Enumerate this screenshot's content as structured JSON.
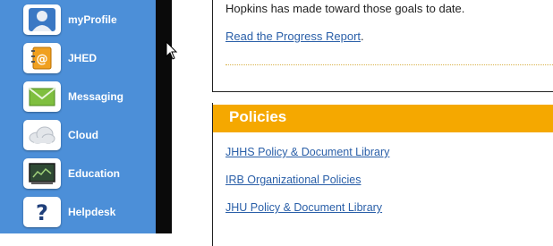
{
  "launcher": {
    "items": [
      {
        "label": "myProfile",
        "icon": "user-profile-icon"
      },
      {
        "label": "JHED",
        "icon": "address-book-icon"
      },
      {
        "label": "Messaging",
        "icon": "envelope-icon"
      },
      {
        "label": "Cloud",
        "icon": "cloud-icon"
      },
      {
        "label": "Education",
        "icon": "chalkboard-icon"
      },
      {
        "label": "Helpdesk",
        "icon": "question-mark-icon"
      }
    ],
    "accent": "#4c8fd8"
  },
  "progress": {
    "text": "Hopkins has made toward those goals to date.",
    "link_label": "Read the Progress Report",
    "after_link": "."
  },
  "policies": {
    "title": "Policies",
    "header_color": "#f5a800",
    "links": [
      "JHHS Policy & Document Library",
      "IRB Organizational Policies",
      "JHU Policy & Document Library"
    ]
  }
}
